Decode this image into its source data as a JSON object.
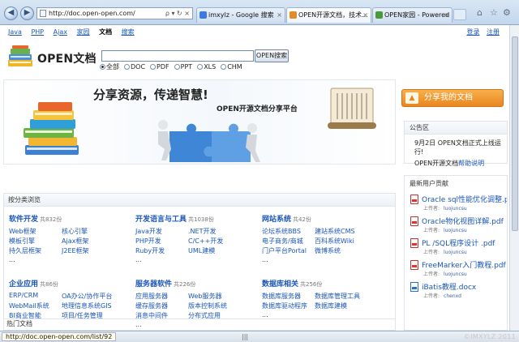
{
  "browser": {
    "address": "http://doc.open-open.com/",
    "address_tools": "ρ ▾ ↻ ×",
    "tabs": [
      {
        "label": "imxylz - Google 搜索",
        "color": "#3d7be0"
      },
      {
        "label": "OPEN开源文档，技术...",
        "color": "#e48a2a"
      },
      {
        "label": "OPEN家园 - Powered b...",
        "color": "#4a9a3a"
      }
    ],
    "close_glyph": "×",
    "back_glyph": "◀",
    "forward_glyph": "▶",
    "home_glyph": "⌂",
    "fav_glyph": "☆",
    "gear_glyph": "⚙"
  },
  "topnav": {
    "links": [
      "Java",
      "PHP",
      "Ajax",
      "家园"
    ],
    "current": "文档",
    "last": "搜索",
    "login": "登录",
    "register": "注册"
  },
  "logo": {
    "name": "OPEN文档"
  },
  "search": {
    "button": "OPEN搜索",
    "options": [
      "全部",
      "DOC",
      "PDF",
      "PPT",
      "XLS",
      "CHM"
    ],
    "selected": "全部"
  },
  "banner": {
    "slogan": "分享资源，传递智慧!",
    "subtitle": "OPEN开源文档分享平台"
  },
  "share_button": "分享我的文档",
  "notice": {
    "title": "公告区",
    "line1": "9月2日 OPEN文档正式上线运行!",
    "line2_prefix": "OPEN开源文档",
    "line2_link": "帮助说明"
  },
  "contrib": {
    "title": "最新用户贡献",
    "uploader_label": "上传者:",
    "items": [
      {
        "title": "Oracle sql性能优化调整.pdf",
        "uploader": "luojuncsu",
        "type": "pdf"
      },
      {
        "title": "Oracle物化视图详解.pdf",
        "uploader": "luojuncsu",
        "type": "pdf"
      },
      {
        "title": "PL /SQL程序设计 .pdf",
        "uploader": "luojuncsu",
        "type": "pdf"
      },
      {
        "title": "FreeMarker入门教程.pdf",
        "uploader": "luojuncsu",
        "type": "pdf"
      },
      {
        "title": "iBatis教程.docx",
        "uploader": "chenxd",
        "type": "doc"
      }
    ]
  },
  "categories": {
    "title": "按分类浏览",
    "more": "...",
    "groups": [
      {
        "name": "软件开发",
        "count": "共832份",
        "links": [
          "Web框架",
          "核心引擎",
          "模板引擎",
          "Ajax框架",
          "持久层框架",
          "J2EE框架"
        ]
      },
      {
        "name": "开发语言与工具",
        "count": "共1038份",
        "links": [
          "Java开发",
          ".NET开发",
          "PHP开发",
          "C/C++开发",
          "Ruby开发",
          "UML建模"
        ]
      },
      {
        "name": "网站系统",
        "count": "共42份",
        "links": [
          "论坛系统BBS",
          "建站系统CMS",
          "电子商务/商城",
          "百科系统Wiki",
          "门户平台Portal",
          "微博系统"
        ]
      },
      {
        "name": "企业应用",
        "count": "共86份",
        "links": [
          "ERP/CRM",
          "OA办公/协作平台",
          "WebMail系统",
          "地理信息系统GIS",
          "BI商业智能",
          "项目/任务管理"
        ]
      },
      {
        "name": "服务器软件",
        "count": "共226份",
        "links": [
          "应用服务器",
          "Web服务器",
          "缓存服务器",
          "版本控制系统",
          "消息中间件",
          "分布式应用"
        ]
      },
      {
        "name": "数据库相关",
        "count": "共256份",
        "links": [
          "数据库服务器",
          "数据库管理工具",
          "数据库驱动程序",
          "数据库建模"
        ]
      }
    ]
  },
  "hot_docs": "热门文档",
  "status": {
    "url": "http://doc.open-open.com/list/92",
    "grip": "|||",
    "watermark": "©IMXYLZ 2011"
  }
}
